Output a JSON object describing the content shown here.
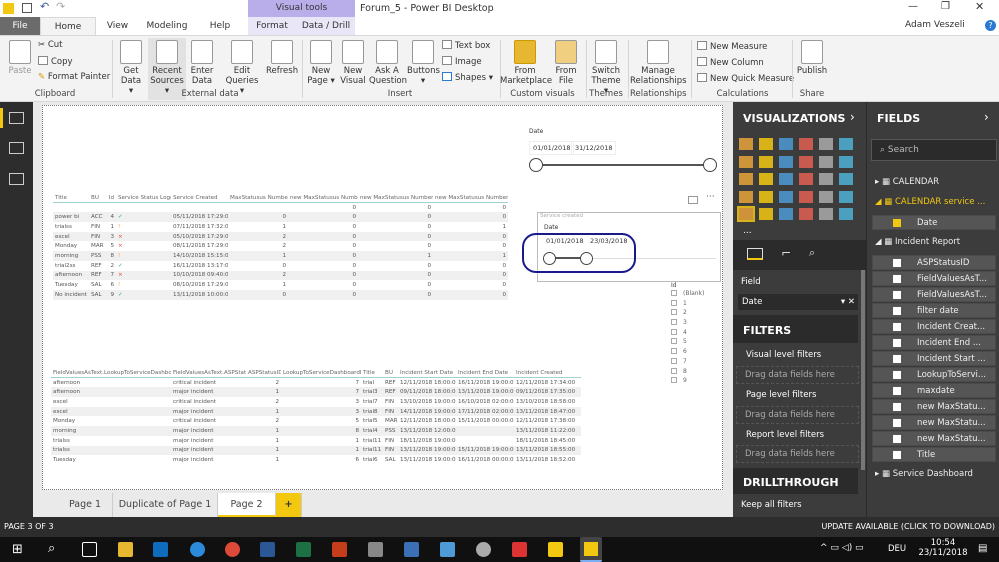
{
  "window": {
    "title": "Forum_5 - Power BI Desktop",
    "user": "Adam Veszeli",
    "contextual_tab_group": "Visual tools"
  },
  "tabs": [
    "File",
    "Home",
    "View",
    "Modeling",
    "Help",
    "Format",
    "Data / Drill"
  ],
  "ribbon": {
    "clipboard": {
      "paste": "Paste",
      "cut": "Cut",
      "copy": "Copy",
      "format_painter": "Format Painter",
      "group": "Clipboard"
    },
    "external": {
      "get_data": "Get Data ▾",
      "recent": "Recent Sources ▾",
      "enter": "Enter Data",
      "edit": "Edit Queries ▾",
      "refresh": "Refresh",
      "group": "External data"
    },
    "insert": {
      "new_page": "New Page ▾",
      "new_visual": "New Visual",
      "ask": "Ask A Question",
      "buttons": "Buttons ▾",
      "text_box": "Text box",
      "image": "Image",
      "shapes": "Shapes ▾",
      "group": "Insert"
    },
    "custom": {
      "marketplace": "From Marketplace",
      "file": "From File",
      "group": "Custom visuals"
    },
    "themes": {
      "switch": "Switch Theme ▾",
      "group": "Themes"
    },
    "relationships": {
      "manage": "Manage Relationships",
      "group": "Relationships"
    },
    "calculations": {
      "measure": "New Measure",
      "column": "New Column",
      "quick": "New Quick Measure",
      "group": "Calculations"
    },
    "share": {
      "publish": "Publish",
      "group": "Share"
    }
  },
  "slicer1": {
    "title": "Date",
    "start": "01/01/2018",
    "end": "31/12/2018"
  },
  "slicer2": {
    "header": "Service created",
    "title": "Date",
    "start": "01/01/2018",
    "end": "23/03/2018"
  },
  "id_slicer": {
    "title": "Id",
    "options": [
      "(Blank)",
      "1",
      "2",
      "3",
      "4",
      "5",
      "6",
      "7",
      "8",
      "9"
    ]
  },
  "table1": {
    "headers": [
      "Title",
      "BU",
      "Id",
      "Service Status Logo",
      "Service Created",
      "MaxStatusus Number",
      "new MaxStatusus Number",
      "new MaxStatusus Number 2",
      "new MaxStatusus Number 3"
    ],
    "rows": [
      [
        "",
        "",
        "",
        "",
        "",
        "",
        "0",
        "0",
        "0"
      ],
      [
        "power bi",
        "ACC",
        "4",
        "ok",
        "05/11/2018 17:29:00",
        "0",
        "0",
        "0",
        "0"
      ],
      [
        "trialss",
        "FIN",
        "1",
        "warn",
        "07/11/2018 17:32:00",
        "1",
        "0",
        "0",
        "1"
      ],
      [
        "excel",
        "FIN",
        "3",
        "error",
        "05/10/2018 17:29:00",
        "2",
        "0",
        "0",
        "0"
      ],
      [
        "Monday",
        "MAR",
        "5",
        "error",
        "08/11/2018 17:29:00",
        "2",
        "0",
        "0",
        "0"
      ],
      [
        "morning",
        "PSS",
        "8",
        "warn",
        "14/10/2018 15:15:00",
        "1",
        "0",
        "1",
        "1"
      ],
      [
        "trial2ss",
        "REF",
        "2",
        "ok",
        "16/11/2018 13:17:00",
        "0",
        "0",
        "0",
        "0"
      ],
      [
        "afternoon",
        "REF",
        "7",
        "error",
        "10/10/2018 09:40:00",
        "2",
        "0",
        "0",
        "0"
      ],
      [
        "Tuesday",
        "SAL",
        "6",
        "warn",
        "08/10/2018 17:29:00",
        "1",
        "0",
        "0",
        "0"
      ],
      [
        "No incident",
        "SAL",
        "9",
        "ok",
        "13/11/2018 10:00:00",
        "0",
        "0",
        "0",
        "0"
      ]
    ]
  },
  "status_colors": {
    "ok": "#3cb371",
    "warn": "#f0a030",
    "error": "#e04040"
  },
  "table2": {
    "headers": [
      "FieldValuesAsText.LookupToServiceDashboard",
      "FieldValuesAsText.ASPStatus",
      "ASPStatusID",
      "LookupToServiceDashboardID",
      "Title",
      "BU",
      "Incident Start Date",
      "Incident End Date",
      "Incident Created"
    ],
    "rows": [
      [
        "afternoon",
        "critical incident",
        "2",
        "7",
        "trial",
        "REF",
        "12/11/2018 18:00:00",
        "16/11/2018 19:00:00",
        "12/11/2018 17:34:00"
      ],
      [
        "afternoon",
        "major incident",
        "1",
        "7",
        "trial3",
        "REF",
        "09/11/2018 18:00:00",
        "13/11/2018 19:00:00",
        "09/11/2018 17:35:00"
      ],
      [
        "excel",
        "critical incident",
        "2",
        "3",
        "trial7",
        "FIN",
        "13/10/2018 19:00:00",
        "16/10/2018 02:00:00",
        "13/10/2018 18:58:00"
      ],
      [
        "excel",
        "major incident",
        "1",
        "3",
        "trial8",
        "FIN",
        "14/11/2018 19:00:00",
        "17/11/2018 02:00:00",
        "13/11/2018 18:47:00"
      ],
      [
        "Monday",
        "critical incident",
        "2",
        "5",
        "trial5",
        "MAR",
        "12/11/2018 18:00:00",
        "15/11/2018 00:00:00",
        "12/11/2018 17:38:00"
      ],
      [
        "morning",
        "major incident",
        "1",
        "8",
        "trial4",
        "PSS",
        "13/11/2018 12:00:00",
        "",
        "13/11/2018 11:22:00"
      ],
      [
        "trialss",
        "major incident",
        "1",
        "1",
        "trial11",
        "FIN",
        "18/11/2018 19:00:00",
        "",
        "18/11/2018 18:45:00"
      ],
      [
        "trialss",
        "major incident",
        "1",
        "1",
        "trial11",
        "FIN",
        "13/11/2018 19:00:00",
        "15/11/2018 19:00:00",
        "13/11/2018 18:55:00"
      ],
      [
        "Tuesday",
        "major incident",
        "1",
        "6",
        "trial6",
        "SAL",
        "13/11/2018 19:00:00",
        "16/11/2018 00:00:00",
        "13/11/2018 18:52:00"
      ]
    ]
  },
  "page_tabs": [
    "Page 1",
    "Duplicate of Page 1",
    "Page 2"
  ],
  "add_page": "+",
  "visualizations": {
    "title": "VISUALIZATIONS",
    "field_label": "Field",
    "field_value": "Date",
    "more": "...",
    "filters_title": "FILTERS",
    "visual_filters": "Visual level filters",
    "page_filters": "Page level filters",
    "report_filters": "Report level filters",
    "drag": "Drag data fields here",
    "drillthrough": "DRILLTHROUGH",
    "keep_all": "Keep all filters"
  },
  "fields": {
    "title": "FIELDS",
    "search_placeholder": "Search",
    "tables": [
      "CALENDAR",
      "CALENDAR service ...",
      "Incident Report",
      "Service Dashboard"
    ],
    "calendar_service_items": [
      "Date"
    ],
    "incident_items": [
      "ASPStatusID",
      "FieldValuesAsT...",
      "FieldValuesAsT...",
      "filter date",
      "Incident Creat...",
      "Incident End ...",
      "Incident Start ...",
      "LookupToServi...",
      "maxdate",
      "new MaxStatu...",
      "new MaxStatu...",
      "new MaxStatu...",
      "Title"
    ]
  },
  "status": {
    "page": "PAGE 3 OF 3",
    "update": "UPDATE AVAILABLE (CLICK TO DOWNLOAD)"
  },
  "taskbar": {
    "lang": "DEU",
    "time": "10:54",
    "date": "23/11/2018"
  }
}
